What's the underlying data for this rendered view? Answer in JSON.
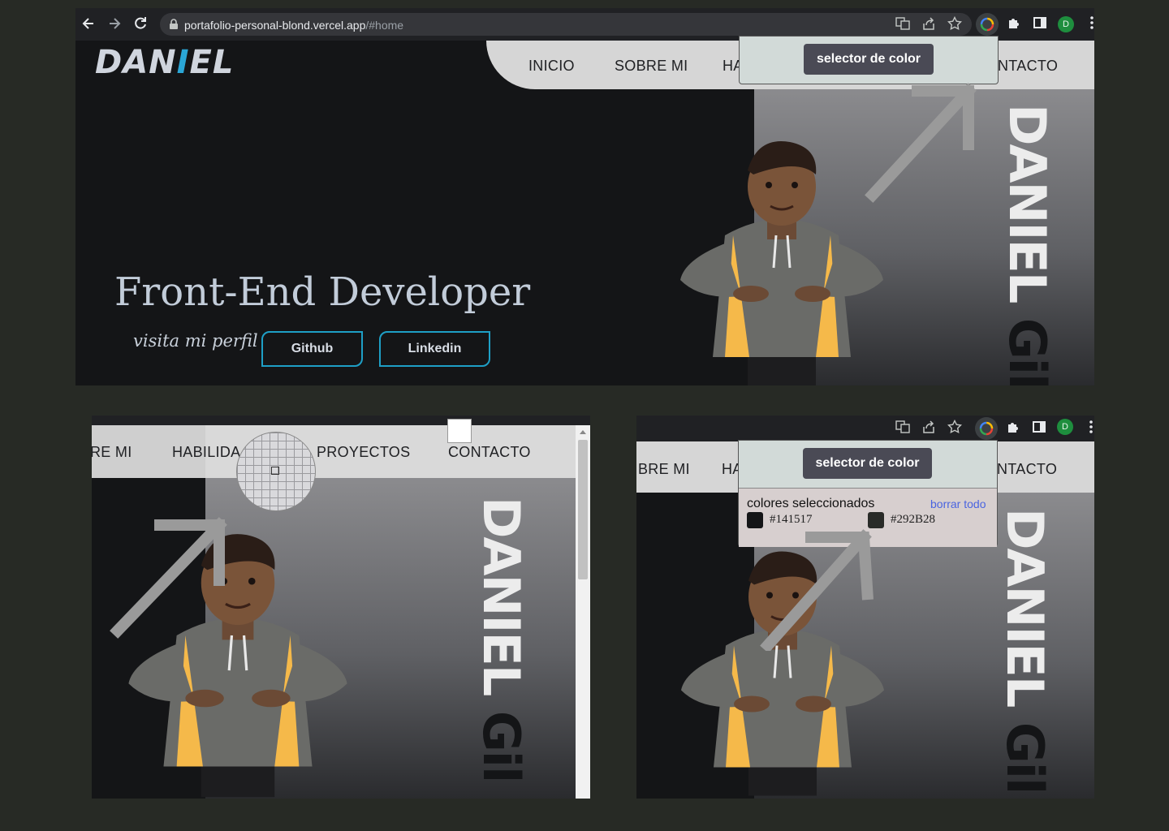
{
  "browser": {
    "url_host": "portafolio-personal-blond.vercel.app",
    "url_path": "/#home",
    "avatar_letter": "D"
  },
  "site": {
    "logo_pre": "DAN",
    "logo_hi": "I",
    "logo_post": "EL",
    "nav_panel1": [
      "INICIO",
      "SOBRE MI",
      "HA",
      "NTACTO"
    ],
    "nav_panel2": [
      "RE MI",
      "HABILIDA",
      "PROYECTOS",
      "CONTACTO"
    ],
    "nav_panel3": [
      "BRE MI",
      "HA",
      "NTACTO"
    ],
    "title": "Front-End Developer",
    "subtitle": "visita mi perfil",
    "btn_github": "Github",
    "btn_linkedin": "Linkedin",
    "vertical_name": "DANIEL",
    "vertical_surname": "Gil"
  },
  "extension": {
    "picker_label": "selector de color",
    "selected_title": "colores seleccionados",
    "clear_label": "borrar todo",
    "colors": [
      {
        "hex": "#141517",
        "color": "#141517"
      },
      {
        "hex": "#292B28",
        "color": "#292B28"
      }
    ]
  },
  "theme": {
    "accent": "#2aa6d6",
    "page_bg": "#141517",
    "backdrop": "#272a25"
  }
}
